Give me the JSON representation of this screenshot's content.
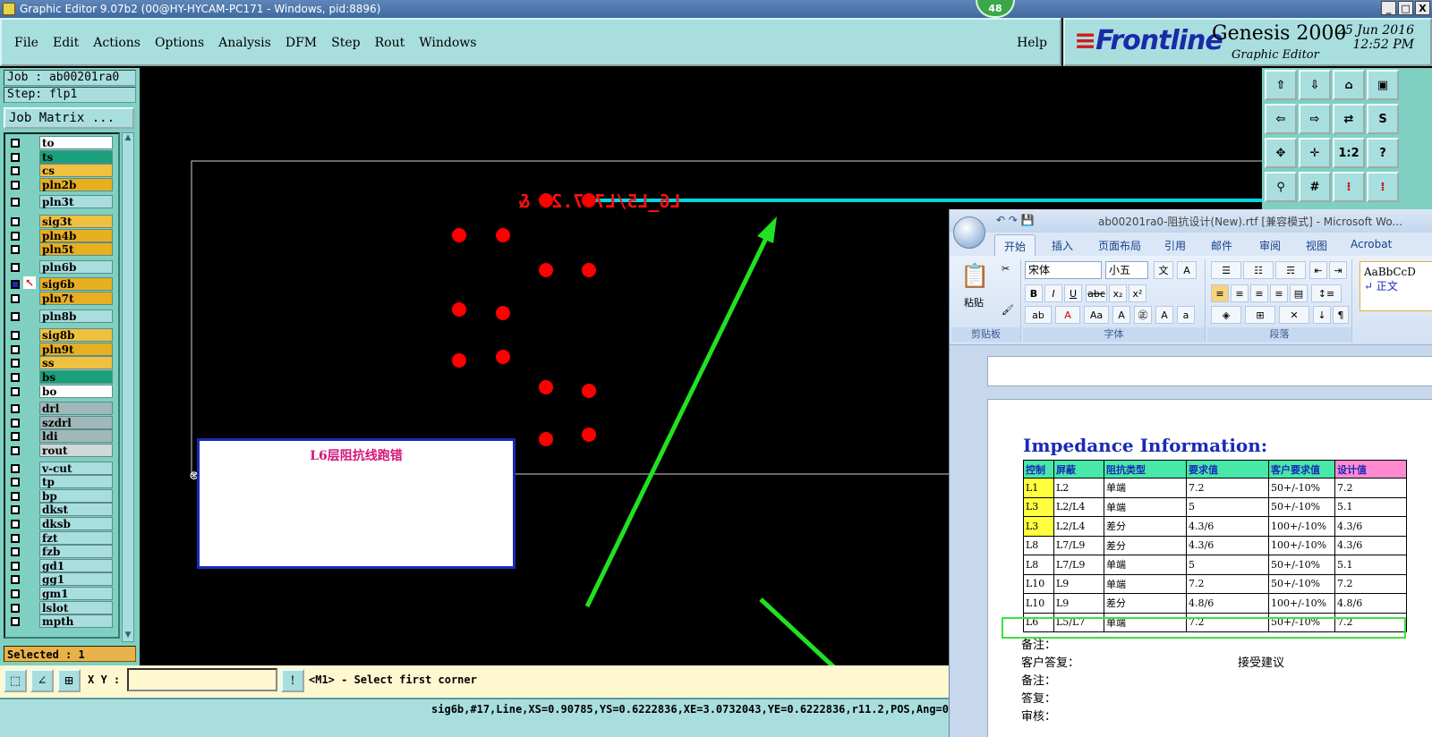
{
  "window": {
    "title": "Graphic Editor 9.07b2 (00@HY-HYCAM-PC171 - Windows, pid:8896)",
    "badge": "48",
    "min": "_",
    "max": "□",
    "close": "X"
  },
  "menu": {
    "items": [
      "File",
      "Edit",
      "Actions",
      "Options",
      "Analysis",
      "DFM",
      "Step",
      "Rout",
      "Windows"
    ],
    "help": "Help"
  },
  "brand": {
    "logo": "Frontline",
    "product": "Genesis 2000",
    "sub": "Graphic Editor",
    "date": "25 Jun 2016",
    "time": "12:52 PM"
  },
  "job": {
    "job_label": "Job : ab00201ra0",
    "step_label": "Step: flp1",
    "matrix_btn": "Job Matrix ..."
  },
  "layers": [
    "to",
    "ts",
    "cs",
    "pln2b",
    "pln3t",
    "sig3t",
    "pln4b",
    "pln5t",
    "pln6b",
    "sig6b",
    "pln7t",
    "pln8b",
    "sig8b",
    "pln9t",
    "ss",
    "bs",
    "bo",
    "drl",
    "szdrl",
    "ldi",
    "rout",
    "v-cut",
    "tp",
    "bp",
    "dkst",
    "dksb",
    "fzt",
    "fzb",
    "gd1",
    "gg1",
    "gm1",
    "lslot",
    "mpth"
  ],
  "selected": "Selected : 1",
  "canvas": {
    "mirror_text": "L6_L5/L7 7.20 &",
    "note_box": "L6层阻抗线跑错"
  },
  "toolbar_right": [
    "1:2",
    "?"
  ],
  "bottom": {
    "xy_label": "X Y :",
    "xy_value": "",
    "prompt": "<M1> - Select first corner",
    "excl": "!"
  },
  "status": "sig6b,#17,Line,XS=0.90785,YS=0.6222836,XE=3.0732043,YE=0.6222836,r11.2,POS,Ang=0",
  "word": {
    "title": "ab00201ra0-阻抗设计(New).rtf [兼容模式] - Microsoft Wo...",
    "tabs": [
      "开始",
      "插入",
      "页面布局",
      "引用",
      "邮件",
      "审阅",
      "视图",
      "Acrobat"
    ],
    "font": "宋体",
    "size": "小五",
    "paste": "粘贴",
    "clipboard": "剪贴板",
    "font_group": "字体",
    "para_group": "段落",
    "style_sample": "AaBbCcD",
    "style_name": "↵ 正文",
    "heading": "Impedance Information:",
    "headers": [
      "控制",
      "屏蔽",
      "阻抗类型",
      "要求值",
      "客户要求值",
      "设计值"
    ],
    "rows": [
      [
        "L1",
        "L2",
        "单端",
        "7.2",
        "50+/-10%",
        "7.2"
      ],
      [
        "L3",
        "L2/L4",
        "单端",
        "5",
        "50+/-10%",
        "5.1"
      ],
      [
        "L3",
        "L2/L4",
        "差分",
        "4.3/6",
        "100+/-10%",
        "4.3/6"
      ],
      [
        "L8",
        "L7/L9",
        "差分",
        "4.3/6",
        "100+/-10%",
        "4.3/6"
      ],
      [
        "L8",
        "L7/L9",
        "单端",
        "5",
        "50+/-10%",
        "5.1"
      ],
      [
        "L10",
        "L9",
        "单端",
        "7.2",
        "50+/-10%",
        "7.2"
      ],
      [
        "L10",
        "L9",
        "差分",
        "4.8/6",
        "100+/-10%",
        "4.8/6"
      ],
      [
        "L6",
        "L5/L7",
        "单端",
        "7.2",
        "50+/-10%",
        "7.2"
      ]
    ],
    "notes": [
      "备注：",
      "客户答复：",
      "备注：",
      "答复：",
      "审核："
    ],
    "accept": "接受建议"
  },
  "colors": {
    "accent_teal": "#a9dede",
    "pad_red": "#ff0000",
    "line_cyan": "#00d8e0",
    "arrow_green": "#22e022",
    "border_blue": "#1a2ab8"
  }
}
